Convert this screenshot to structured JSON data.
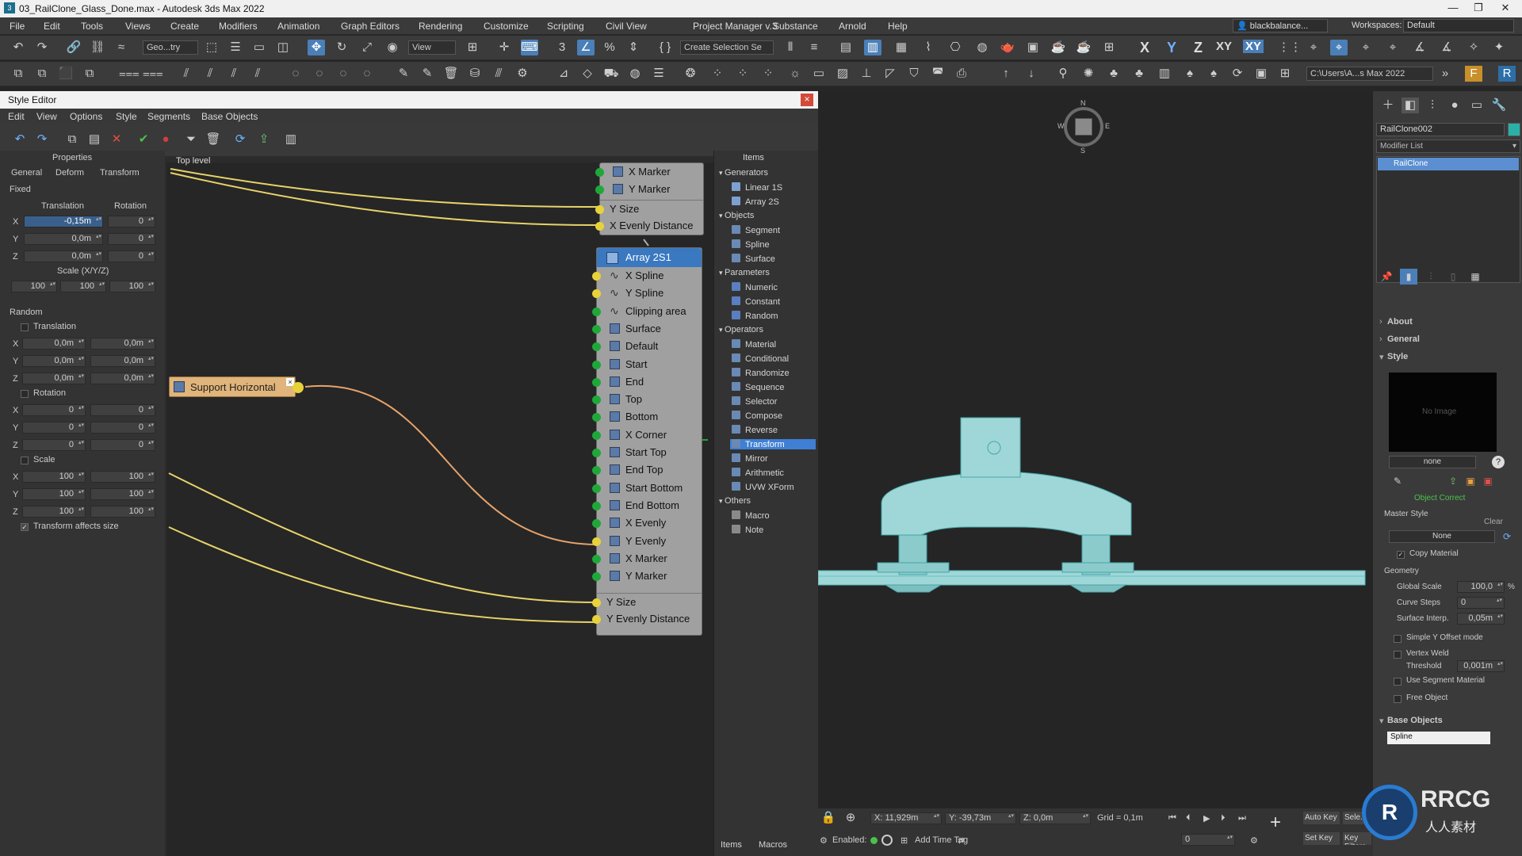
{
  "titlebar": {
    "title": "03_RailClone_Glass_Done.max - Autodesk 3ds Max 2022",
    "minimize": "—",
    "restore": "❐",
    "close": "✕"
  },
  "menu": [
    "File",
    "Edit",
    "Tools",
    "Views",
    "Create",
    "Modifiers",
    "Animation",
    "Graph Editors",
    "Rendering",
    "Customize",
    "Scripting",
    "Civil View",
    "Project Manager v.3",
    "Substance",
    "Arnold",
    "Help"
  ],
  "user": "blackbalance...",
  "workspace_label": "Workspaces:",
  "workspace_value": "Default",
  "toolbar": {
    "selection_filter": "Geo...try",
    "ref_coord": "View",
    "named_selection": "Create Selection Se",
    "path": "C:\\Users\\A...s Max 2022",
    "axes": [
      "X",
      "Y",
      "Z",
      "XY",
      "XY"
    ]
  },
  "style_editor": {
    "title": "Style Editor",
    "close": "×",
    "menu": [
      "Edit",
      "View",
      "Options",
      "Style",
      "Segments",
      "Base Objects"
    ],
    "properties": {
      "header": "Properties",
      "tabs": [
        "General",
        "Deform",
        "Transform"
      ],
      "fixed": "Fixed",
      "translation": "Translation",
      "rotation": "Rotation",
      "x": "X",
      "y": "Y",
      "z": "Z",
      "tx": "-0,15m",
      "ty": "0,0m",
      "tz": "0,0m",
      "rx": "0",
      "ry": "0",
      "rz": "0",
      "scale_label": "Scale (X/Y/Z)",
      "scale": [
        "100",
        "100",
        "100"
      ],
      "random": "Random",
      "r_translation": "Translation",
      "r_rotation": "Rotation",
      "r_scale": "Scale",
      "rt": [
        [
          "0,0m",
          "0,0m"
        ],
        [
          "0,0m",
          "0,0m"
        ],
        [
          "0,0m",
          "0,0m"
        ]
      ],
      "rr": [
        [
          "0",
          "0"
        ],
        [
          "0",
          "0"
        ],
        [
          "0",
          "0"
        ]
      ],
      "rs": [
        [
          "100",
          "100"
        ],
        [
          "100",
          "100"
        ],
        [
          "100",
          "100"
        ]
      ],
      "affects": "Transform affects size"
    },
    "top_level": "Top level",
    "support_node": "Support Horizontal",
    "top_node_ports": [
      "X Marker",
      "Y Marker",
      "Y Size",
      "X Evenly Distance"
    ],
    "array_node": {
      "title": "Array 2S1",
      "ports": [
        "X Spline",
        "Y Spline",
        "Clipping area",
        "Surface",
        "Default",
        "Start",
        "End",
        "Top",
        "Bottom",
        "X Corner",
        "Start Top",
        "End Top",
        "Start Bottom",
        "End Bottom",
        "X Evenly",
        "Y Evenly",
        "X Marker",
        "Y Marker"
      ],
      "params": [
        "Y Size",
        "Y Evenly Distance"
      ]
    },
    "items": {
      "header": "Items",
      "groups": [
        {
          "name": "Generators",
          "items": [
            "Linear 1S",
            "Array 2S"
          ]
        },
        {
          "name": "Objects",
          "items": [
            "Segment",
            "Spline",
            "Surface"
          ]
        },
        {
          "name": "Parameters",
          "items": [
            "Numeric",
            "Constant",
            "Random"
          ]
        },
        {
          "name": "Operators",
          "items": [
            "Material",
            "Conditional",
            "Randomize",
            "Sequence",
            "Selector",
            "Compose",
            "Reverse",
            "Transform",
            "Mirror",
            "Arithmetic",
            "UVW XForm"
          ]
        },
        {
          "name": "Others",
          "items": [
            "Macro",
            "Note"
          ]
        }
      ],
      "selected": "Transform",
      "tabs": [
        "Items",
        "Macros"
      ]
    }
  },
  "viewcube": {
    "n": "N",
    "w": "W",
    "e": "E",
    "s": "S"
  },
  "command_panel": {
    "object_name": "RailClone002",
    "modifier_list": "Modifier List",
    "stack_item": "RailClone",
    "rollouts": [
      "About",
      "General",
      "Style"
    ],
    "no_image": "No Image",
    "style_name": "none",
    "object_correct": "Object Correct",
    "master_style": "Master Style",
    "clear": "Clear",
    "master_value": "None",
    "copy_material": "Copy Material",
    "geometry": "Geometry",
    "global_scale_label": "Global Scale",
    "global_scale": "100,0",
    "pct": "%",
    "curve_steps_label": "Curve Steps",
    "curve_steps": "0",
    "surface_interp_label": "Surface Interp.",
    "surface_interp": "0,05m",
    "simple_y": "Simple Y Offset mode",
    "vertex_weld": "Vertex Weld",
    "threshold_label": "Threshold",
    "threshold": "0,001m",
    "use_segment_material": "Use Segment Material",
    "free_object": "Free Object",
    "base_objects": "Base Objects",
    "base_item": "Spline"
  },
  "status": {
    "x": "X: 11,929m",
    "y": "Y: -39,73m",
    "z": "Z: 0,0m",
    "grid": "Grid = 0,1m",
    "enabled": "Enabled:",
    "add_time_tag": "Add Time Tag",
    "auto_key": "Auto Key",
    "selected": "Sele...",
    "set_key": "Set Key",
    "key_filters": "Key Filters...",
    "frame": "0"
  },
  "watermark": "RRCG",
  "watermark_sub": "人人素材"
}
